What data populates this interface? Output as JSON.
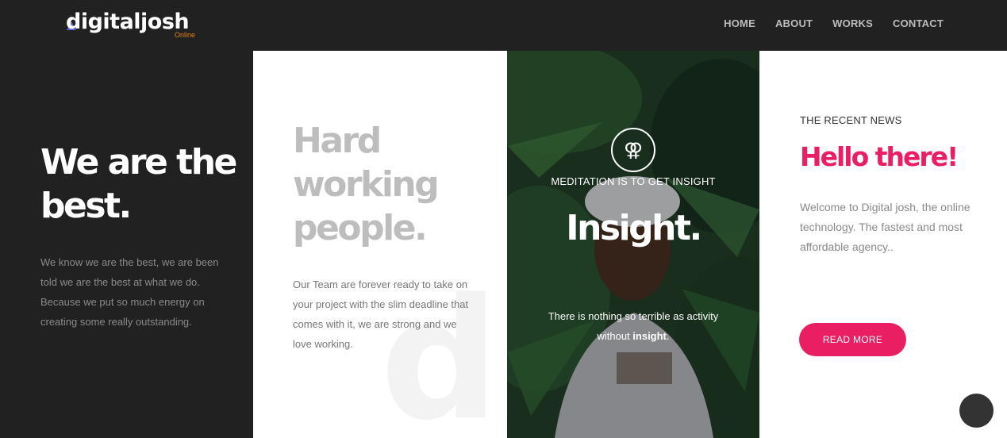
{
  "header": {
    "logo_text": "digitaljosh",
    "logo_sub": "Online",
    "nav": [
      "HOME",
      "ABOUT",
      "WORKS",
      "CONTACT"
    ]
  },
  "col1": {
    "heading_line1": "We are the",
    "heading_line2": "best.",
    "body": "We know we are the best, we are been told we are the best at what we do. Because we put so much energy on creating some really outstanding."
  },
  "col2": {
    "heading_line1": "Hard",
    "heading_line2": "working",
    "heading_line3": "people.",
    "body": "Our Team are forever ready to take on your project with the slim deadline that comes with it, we are strong and we love working.",
    "watermark": "di"
  },
  "col3": {
    "icon": "gender-icon",
    "subtitle": "MEDITATION IS TO GET INSIGHT",
    "heading": "Insight.",
    "body_prefix": "There is nothing so terrible as activity without ",
    "body_bold": "insight",
    "body_suffix": "."
  },
  "col4": {
    "label": "THE RECENT NEWS",
    "heading": "Hello there!",
    "body": "Welcome to Digital josh, the online technology. The fastest and most affordable agency..",
    "button": "READ MORE"
  },
  "colors": {
    "accent": "#e91e63",
    "dark": "#212121",
    "logo_sub": "#e8801e"
  }
}
